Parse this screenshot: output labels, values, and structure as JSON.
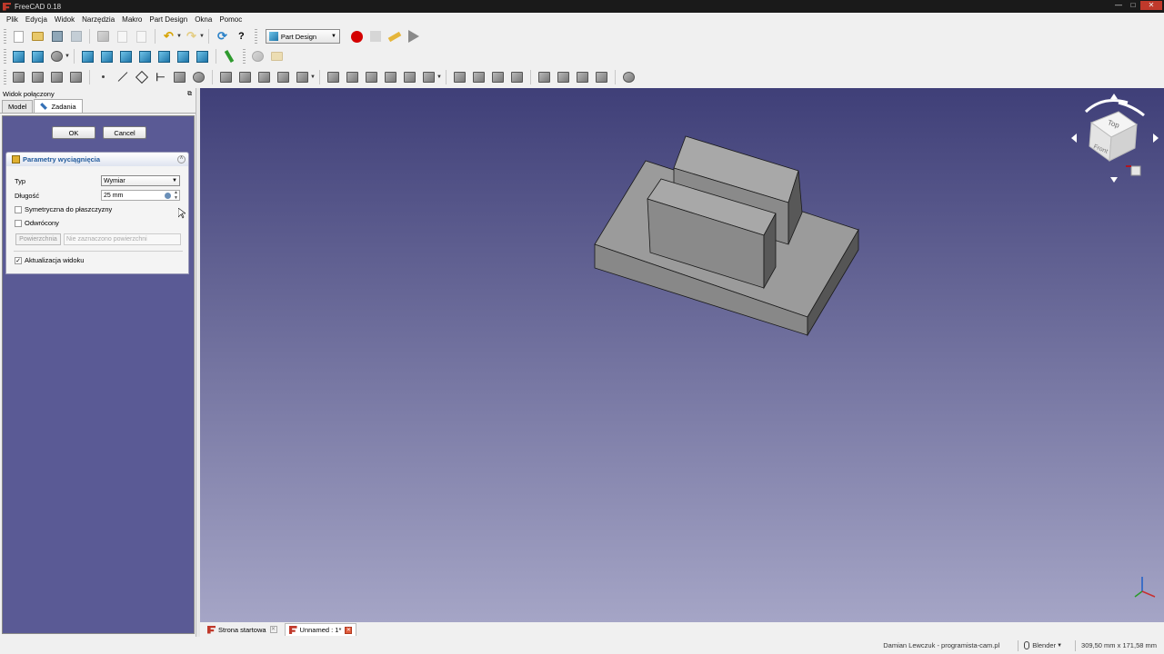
{
  "window": {
    "title": "FreeCAD 0.18"
  },
  "menu": [
    "Plik",
    "Edycja",
    "Widok",
    "Narzędzia",
    "Makro",
    "Part Design",
    "Okna",
    "Pomoc"
  ],
  "toolbar": {
    "workbench": "Part Design"
  },
  "combo_view": {
    "title": "Widok połączony",
    "tabs": [
      "Model",
      "Zadania"
    ],
    "ok_label": "OK",
    "cancel_label": "Cancel",
    "task": {
      "title": "Parametry wyciągnięcia",
      "type_label": "Typ",
      "type_value": "Wymiar",
      "length_label": "Długość",
      "length_value": "25 mm",
      "symmetric_label": "Symetryczna do płaszczyzny",
      "symmetric_checked": false,
      "reversed_label": "Odwrócony",
      "reversed_checked": false,
      "face_button": "Powierzchnia",
      "face_placeholder": "Nie zaznaczono powierzchni",
      "update_view_label": "Aktualizacja widoku",
      "update_view_checked": true
    }
  },
  "navcube": {
    "top": "Top",
    "front": "Front"
  },
  "doc_tabs": [
    {
      "label": "Strona startowa",
      "active": false
    },
    {
      "label": "Unnamed : 1*",
      "active": true
    }
  ],
  "status": {
    "credit": "Damian Lewczuk - programista-cam.pl",
    "nav_style": "Blender",
    "dimensions": "309,50 mm x 171,58 mm"
  },
  "colors": {
    "viewport_top": "#3f3f78",
    "viewport_bottom": "#a5a5c6",
    "record": "#d40000",
    "task_title": "#215a9c"
  }
}
